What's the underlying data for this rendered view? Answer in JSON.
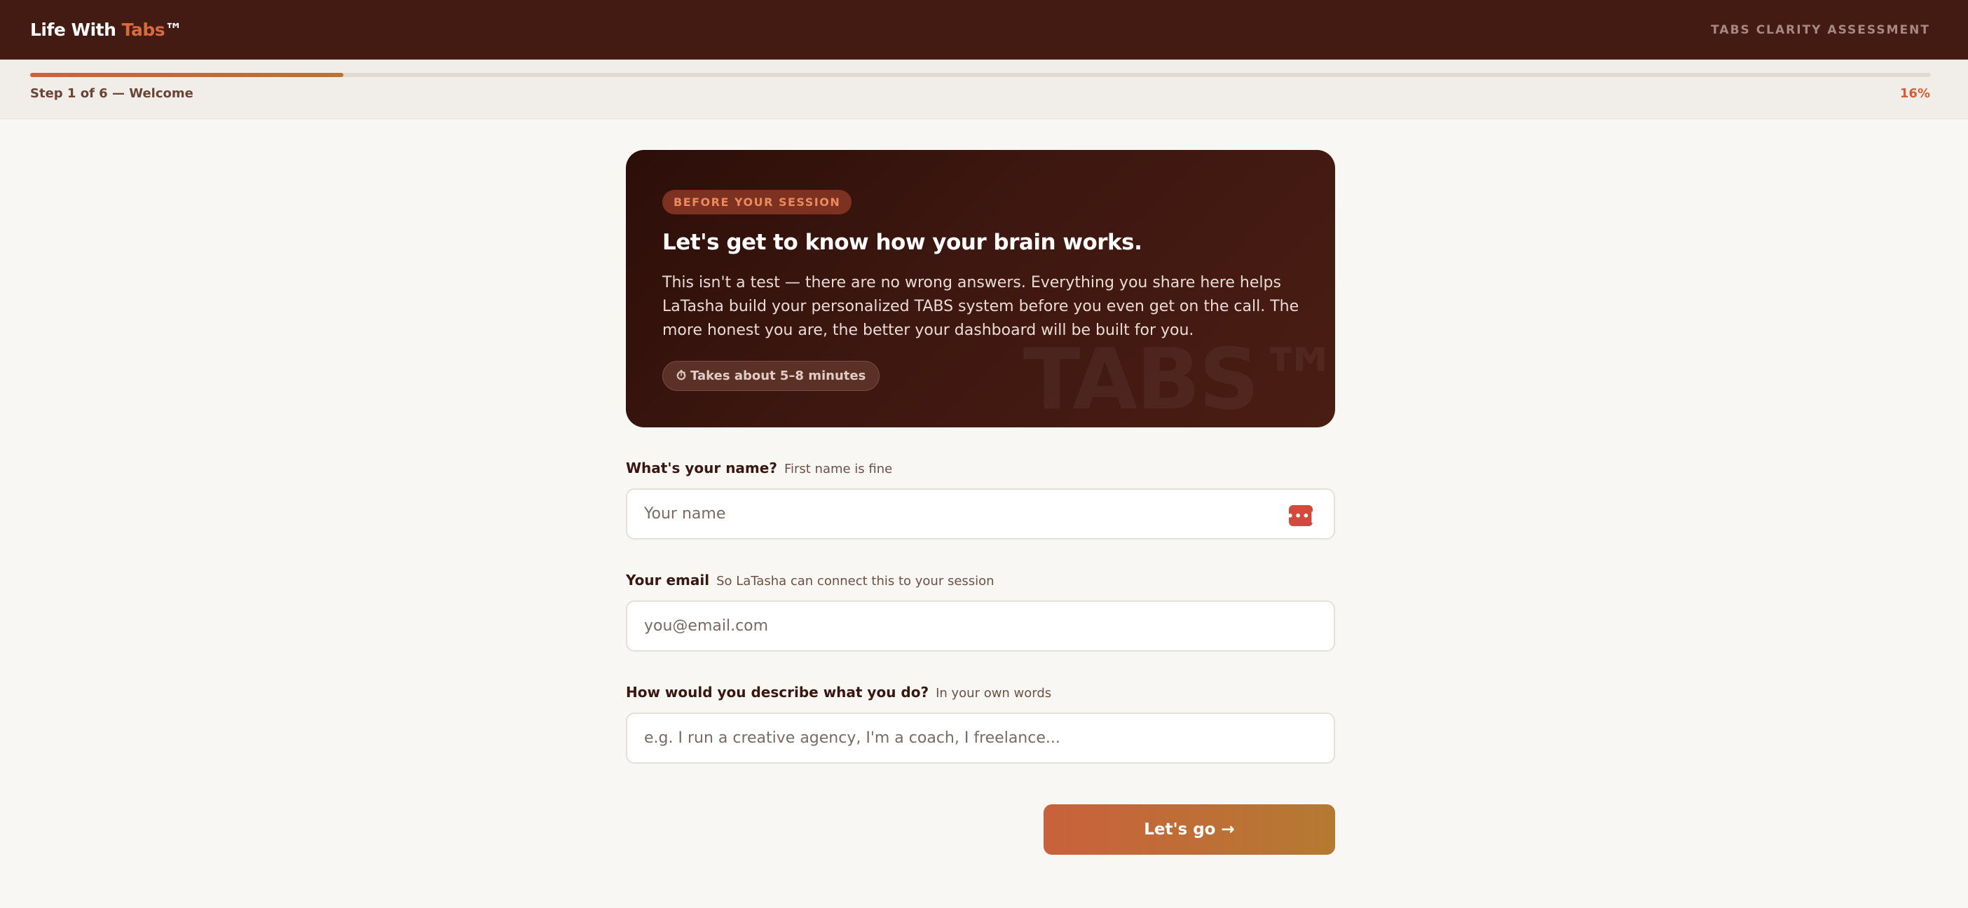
{
  "header": {
    "brand_prefix": "Life With ",
    "brand_accent": "Tabs",
    "brand_suffix": "™",
    "right_label": "TABS CLARITY ASSESSMENT"
  },
  "progress": {
    "step_label": "Step 1 of 6 — Welcome",
    "percent_label": "16%",
    "fraction": 0.165
  },
  "hero": {
    "badge": "BEFORE YOUR SESSION",
    "title": "Let's get to know how your brain works.",
    "body": "This isn't a test — there are no wrong answers. Everything you share here helps LaTasha build your personalized TABS system before you even get on the call. The more honest you are, the better your dashboard will be built for you.",
    "time_icon": "⏱",
    "time_text": "Takes about 5–8 minutes",
    "watermark": "TABS™"
  },
  "form": {
    "name": {
      "question": "What's your name?",
      "hint": "First name is fine",
      "placeholder": "Your name",
      "value": ""
    },
    "email": {
      "question": "Your email",
      "hint": "So LaTasha can connect this to your session",
      "placeholder": "you@email.com",
      "value": ""
    },
    "role": {
      "question": "How would you describe what you do?",
      "hint": "In your own words",
      "placeholder": "e.g. I run a creative agency, I'm a coach, I freelance...",
      "value": ""
    }
  },
  "actions": {
    "go_label": "Let's go →"
  },
  "icons": {
    "password_manager": "password-manager-icon",
    "password_manager_glyph": "•••|"
  },
  "colors": {
    "header_bg": "#431b12",
    "accent": "#d9693f",
    "page_bg": "#f9f7f3",
    "button_start": "#c9613c",
    "button_end": "#b47a31"
  }
}
